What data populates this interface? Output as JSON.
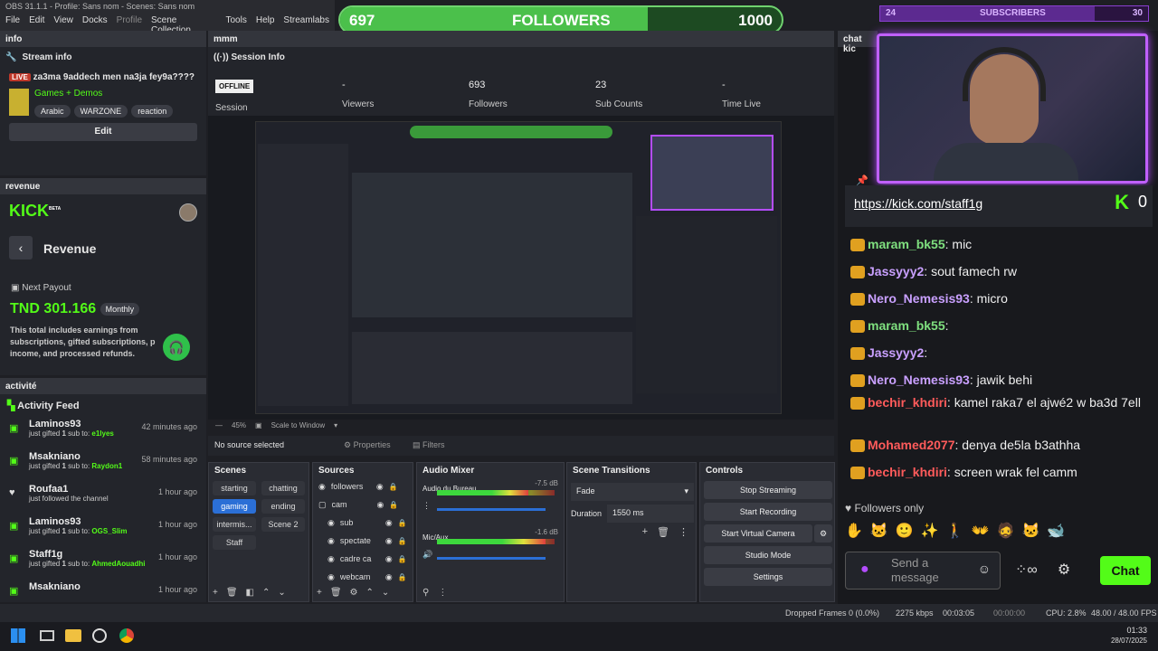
{
  "window": {
    "title": "OBS 31.1.1 - Profile: Sans nom - Scenes: Sans nom"
  },
  "menu": [
    "File",
    "Edit",
    "View",
    "Docks",
    "Profile",
    "Scene Collection",
    "Tools",
    "Help",
    "Streamlabs"
  ],
  "followers_bar": {
    "current": "697",
    "label": "FOLLOWERS",
    "goal": "1000",
    "progress": 0.697
  },
  "subs_bar": {
    "current": "24",
    "label": "SUBSCRIBERS",
    "goal": "30",
    "progress": 0.8
  },
  "info": {
    "dock_title": "info",
    "header": "Stream info",
    "live_badge": "LIVE",
    "stream_title": "za3ma 9addech men na3ja fey9a????",
    "category": "Games + Demos",
    "tags": [
      "Arabic",
      "WARZONE",
      "reaction"
    ],
    "edit_label": "Edit"
  },
  "revenue": {
    "dock_title": "revenue",
    "logo": "KICK",
    "logo_sup": "BETA",
    "title": "Revenue",
    "next_payout_label": "Next Payout",
    "amount": "TND 301.166",
    "currency": "TND",
    "frequency": "Monthly",
    "description": "This total includes earnings from subscriptions, gifted subscriptions, p income, and processed refunds."
  },
  "activity": {
    "dock_title": "activité",
    "header": "Activity Feed",
    "items": [
      {
        "name": "Laminos93",
        "action": "just gifted ",
        "count": "1",
        "mid": " sub to: ",
        "target": "e1lyes",
        "time": "42 minutes ago",
        "icon": "gift"
      },
      {
        "name": "Msakniano",
        "action": "just gifted ",
        "count": "1",
        "mid": " sub to: ",
        "target": "Raydon1",
        "time": "58 minutes ago",
        "icon": "gift"
      },
      {
        "name": "Roufaa1",
        "action": "just followed the channel",
        "count": "",
        "mid": "",
        "target": "",
        "time": "1 hour ago",
        "icon": "heart"
      },
      {
        "name": "Laminos93",
        "action": "just gifted ",
        "count": "1",
        "mid": " sub to: ",
        "target": "OGS_Slim",
        "time": "1 hour ago",
        "icon": "gift"
      },
      {
        "name": "Staff1g",
        "action": "just gifted ",
        "count": "1",
        "mid": " sub to: ",
        "target": "AhmedAouadhi",
        "time": "1 hour ago",
        "icon": "gift"
      },
      {
        "name": "Msakniano",
        "action": "",
        "count": "",
        "mid": "",
        "target": "",
        "time": "1 hour ago",
        "icon": "gift"
      }
    ]
  },
  "session": {
    "dock_title": "mmm",
    "header": "Session Info",
    "status": "OFFLINE",
    "status_label": "Session",
    "viewers": "-",
    "viewers_label": "Viewers",
    "followers": "693",
    "followers_label": "Followers",
    "subs": "23",
    "subs_label": "Sub Counts",
    "time": "-",
    "time_label": "Time Live"
  },
  "preview": {
    "zoom": "45%",
    "scale_label": "Scale to Window"
  },
  "source_bar": {
    "none": "No source selected",
    "properties": "Properties",
    "filters": "Filters"
  },
  "scenes": {
    "title": "Scenes",
    "items": [
      "starting",
      "chatting",
      "gaming",
      "ending",
      "intermis...",
      "Scene 2",
      "Staff"
    ],
    "active": "gaming"
  },
  "sources": {
    "title": "Sources",
    "items": [
      "followers",
      "cam",
      "sub",
      "spectate",
      "cadre ca",
      "webcam"
    ]
  },
  "mixer": {
    "title": "Audio Mixer",
    "channels": [
      {
        "name": "Audio du Bureau",
        "db": "-7.5 dB",
        "level": 0.78
      },
      {
        "name": "Mic/Aux",
        "db": "-1.6 dB",
        "level": 0.92
      }
    ],
    "scale": [
      "-60",
      "-55",
      "-50",
      "-45",
      "-40",
      "-35",
      "-30",
      "-25",
      "-20",
      "-15",
      "-10",
      "-5",
      "0"
    ]
  },
  "transitions": {
    "title": "Scene Transitions",
    "selected": "Fade",
    "duration_label": "Duration",
    "duration": "1550 ms"
  },
  "controls": {
    "title": "Controls",
    "buttons": [
      "Stop Streaming",
      "Start Recording",
      "Start Virtual Camera",
      "Studio Mode",
      "Settings"
    ]
  },
  "chat": {
    "dock_title": "chat kic",
    "url": "https://kick.com/staff1g",
    "viewer_count": "0",
    "messages": [
      {
        "user": "maram_bk55",
        "text": "mic",
        "color": "#7fe07f"
      },
      {
        "user": "Jassyyy2",
        "text": "sout famech rw",
        "color": "#c9a0ff"
      },
      {
        "user": "Nero_Nemesis93",
        "text": "micro",
        "color": "#c9a0ff"
      },
      {
        "user": "maram_bk55",
        "text": "",
        "color": "#7fe07f"
      },
      {
        "user": "Jassyyy2",
        "text": "",
        "color": "#c9a0ff"
      },
      {
        "user": "Nero_Nemesis93",
        "text": "jawik behi",
        "color": "#c9a0ff"
      },
      {
        "user": "bechir_khdiri",
        "text": "kamel raka7 el ajwé2 w ba3d 7ell",
        "color": "#ff5b5b"
      },
      {
        "user": "Mohamed2077",
        "text": "denya de5la b3athha",
        "color": "#ff5b5b"
      },
      {
        "user": "bechir_khdiri",
        "text": "screen wrak fel camm",
        "color": "#ff5b5b"
      }
    ],
    "followers_only": "Followers only",
    "placeholder": "Send a message",
    "chat_button": "Chat"
  },
  "status": {
    "dropped": "Dropped Frames 0 (0.0%)",
    "kbps": "2275 kbps",
    "stream_time": "00:03:05",
    "rec_time": "00:00:00",
    "cpu": "CPU: 2.8%",
    "fps": "48.00 / 48.00 FPS"
  },
  "clock": {
    "time": "01:33",
    "date": "28/07/2025"
  },
  "colors": {
    "kick_green": "#53fc18",
    "neon": "#b44dff",
    "accent_blue": "#2b6fd6"
  }
}
